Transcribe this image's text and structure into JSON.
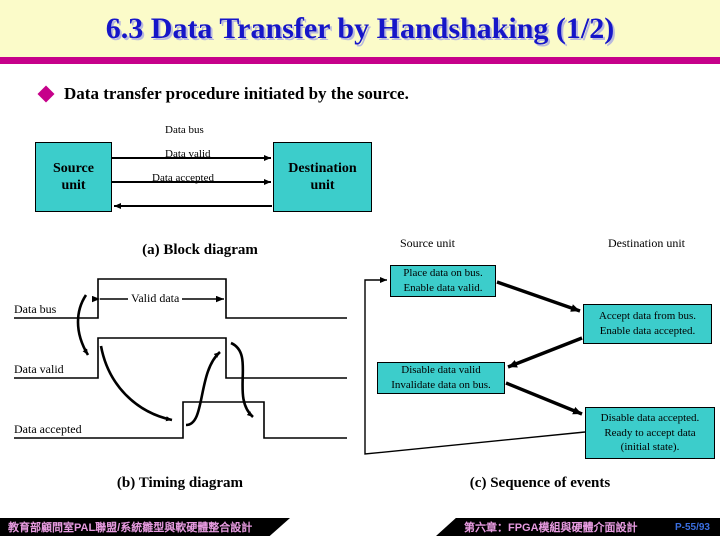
{
  "slide": {
    "title": "6.3 Data Transfer by Handshaking (1/2)",
    "bullet": "Data transfer procedure initiated by the source.",
    "accent_title_color": "#1616c8",
    "accent_rule_color": "#c6018a",
    "banner_color": "#fbfbc9",
    "box_color": "#3ccdcb"
  },
  "block_diagram": {
    "caption": "(a) Block diagram",
    "source_unit": "Source\nunit",
    "source_unit_line1": "Source",
    "source_unit_line2": "unit",
    "destination_unit_line1": "Destination",
    "destination_unit_line2": "unit",
    "signals": [
      {
        "label": "Data bus",
        "direction": "right"
      },
      {
        "label": "Data valid",
        "direction": "right"
      },
      {
        "label": "Data accepted",
        "direction": "left"
      }
    ]
  },
  "timing_diagram": {
    "caption": "(b) Timing diagram",
    "waveforms": [
      {
        "label": "Data bus"
      },
      {
        "label": "Data valid"
      },
      {
        "label": "Data accepted"
      }
    ],
    "annotation": "Valid data"
  },
  "sequence_of_events": {
    "caption": "(c) Sequence of events",
    "column_headers": [
      "Source unit",
      "Destination unit"
    ],
    "steps": [
      {
        "owner": "source",
        "lines": [
          "Place data on bus.",
          "Enable data valid."
        ]
      },
      {
        "owner": "destination",
        "lines": [
          "Accept data from bus.",
          "Enable data accepted."
        ]
      },
      {
        "owner": "source",
        "lines": [
          "Disable data valid",
          "Invalidate data on bus."
        ]
      },
      {
        "owner": "destination",
        "lines": [
          "Disable data accepted.",
          "Ready to accept data",
          "(initial state)."
        ]
      }
    ]
  },
  "footer": {
    "left_text": "教育部顧問室PAL聯盟/系統雛型與軟硬體整合設計",
    "right_text": "第六章：FPGA模組與硬體介面設計",
    "page": "P-55/93"
  }
}
